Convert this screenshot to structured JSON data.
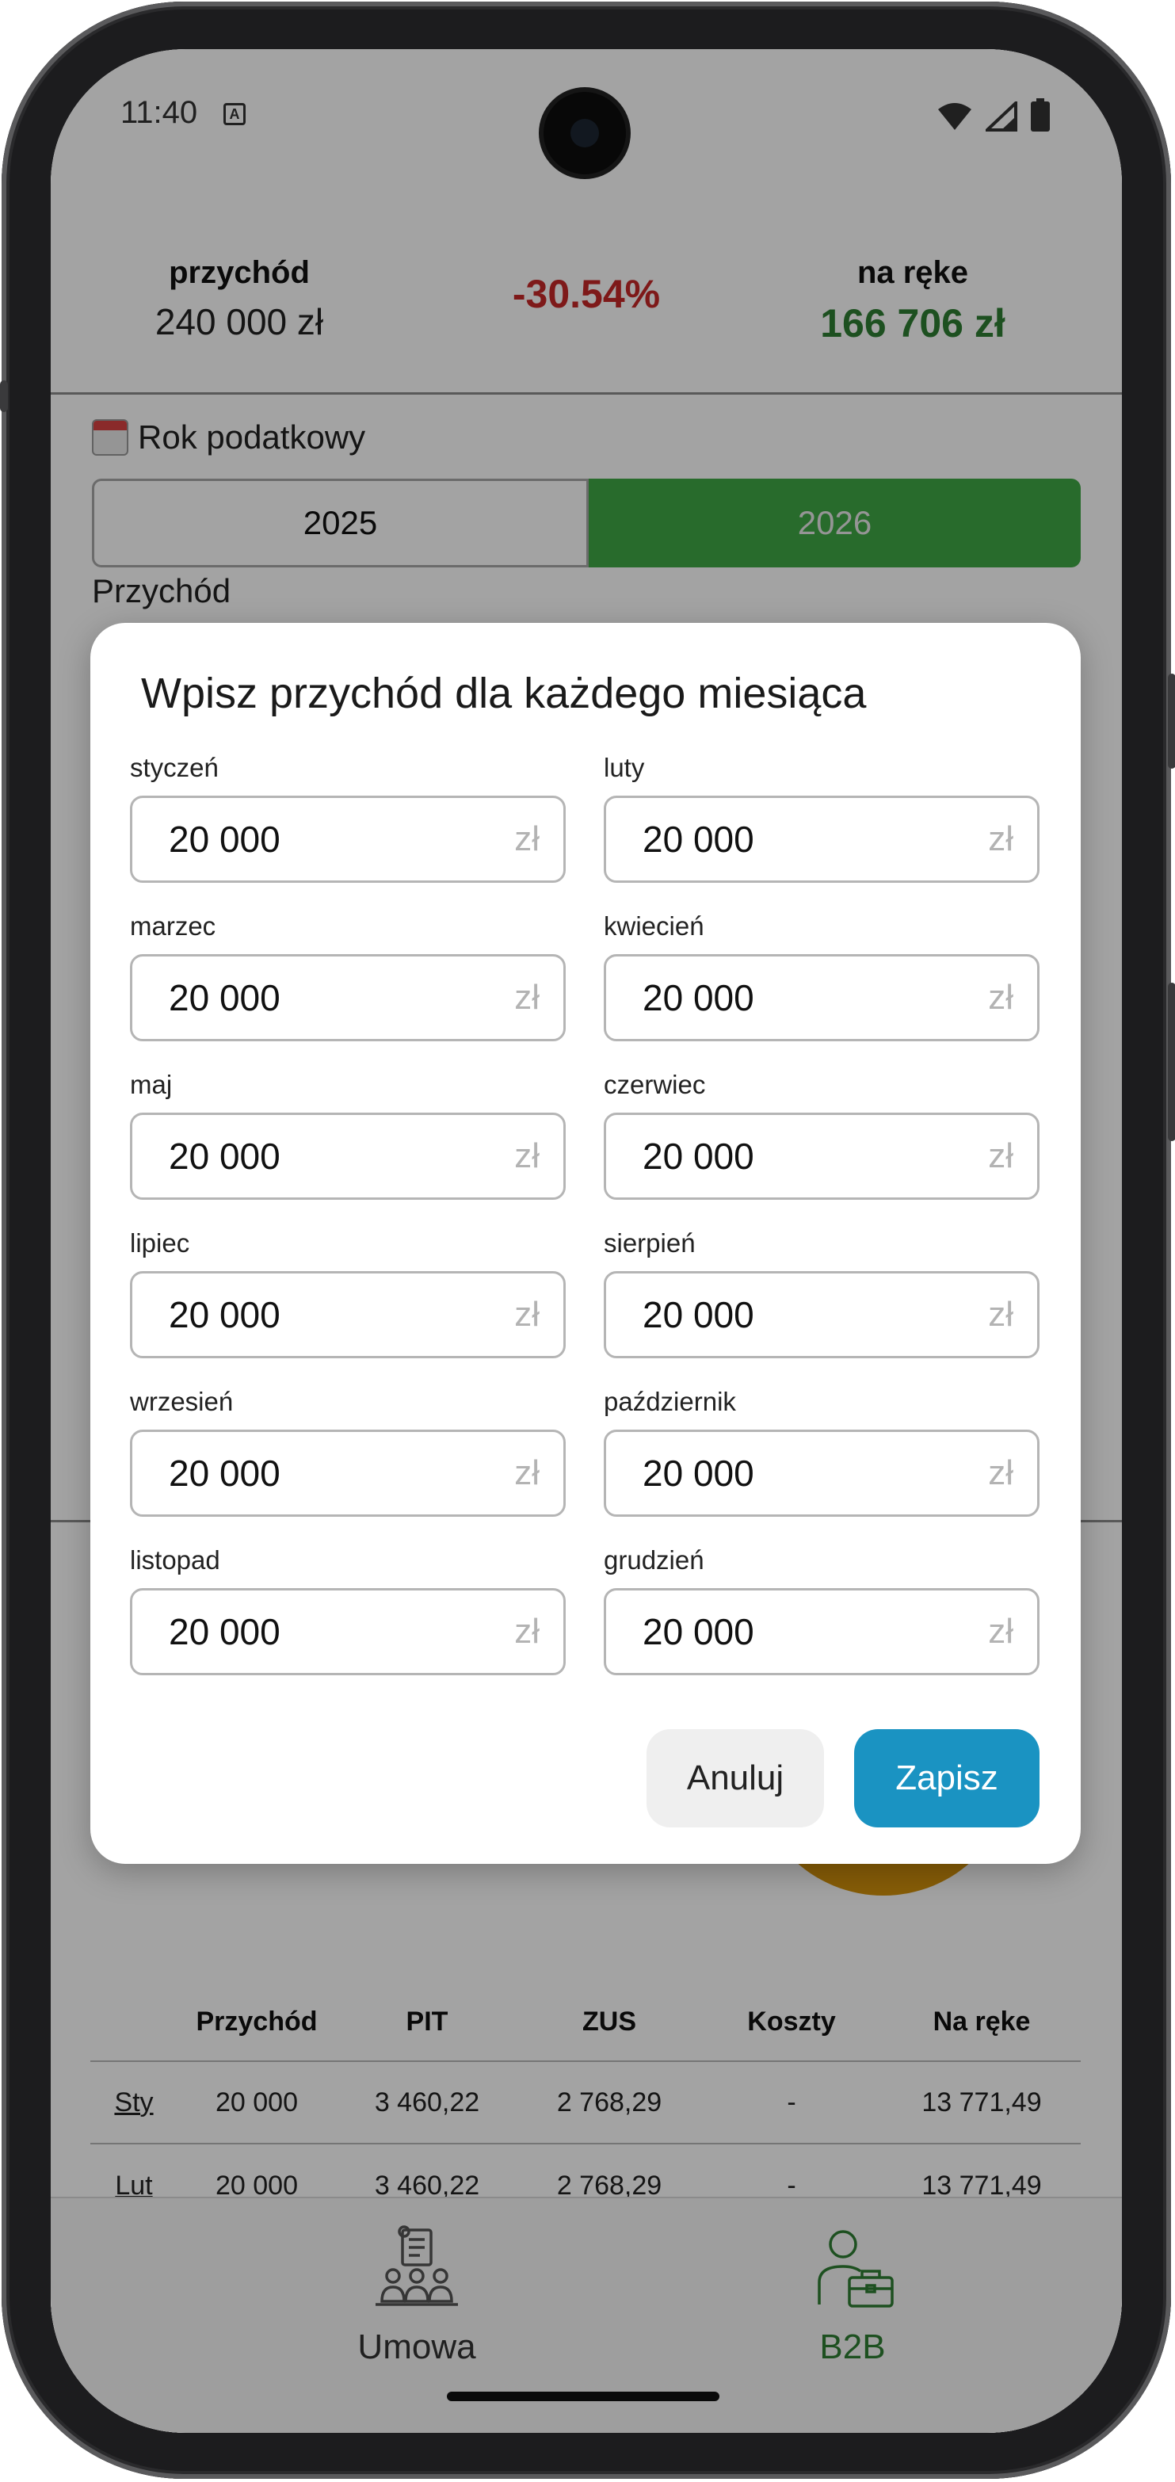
{
  "status_bar": {
    "time": "11:40",
    "badge": "A"
  },
  "summary": {
    "revenue_label": "przychód",
    "revenue_value": "240 000 zł",
    "change_percent": "-30.54%",
    "net_label": "na ręke",
    "net_value": "166 706 zł"
  },
  "tax_year": {
    "label": "Rok podatkowy",
    "options": [
      "2025",
      "2026"
    ],
    "selected": "2026"
  },
  "income_section": {
    "label": "Przychód"
  },
  "modal": {
    "title": "Wpisz przychód dla każdego miesiąca",
    "unit": "zł",
    "months": [
      {
        "label": "styczeń",
        "value": "20 000"
      },
      {
        "label": "luty",
        "value": "20 000"
      },
      {
        "label": "marzec",
        "value": "20 000"
      },
      {
        "label": "kwiecień",
        "value": "20 000"
      },
      {
        "label": "maj",
        "value": "20 000"
      },
      {
        "label": "czerwiec",
        "value": "20 000"
      },
      {
        "label": "lipiec",
        "value": "20 000"
      },
      {
        "label": "sierpień",
        "value": "20 000"
      },
      {
        "label": "wrzesień",
        "value": "20 000"
      },
      {
        "label": "październik",
        "value": "20 000"
      },
      {
        "label": "listopad",
        "value": "20 000"
      },
      {
        "label": "grudzień",
        "value": "20 000"
      }
    ],
    "cancel_label": "Anuluj",
    "save_label": "Zapisz"
  },
  "table": {
    "headers": [
      "",
      "Przychód",
      "PIT",
      "ZUS",
      "Koszty",
      "Na ręke"
    ],
    "rows": [
      [
        "Sty",
        "20 000",
        "3 460,22",
        "2 768,29",
        "-",
        "13 771,49"
      ],
      [
        "Lut",
        "20 000",
        "3 460,22",
        "2 768,29",
        "-",
        "13 771,49"
      ]
    ]
  },
  "bottom_nav": {
    "items": [
      {
        "label": "Umowa",
        "icon": "contract-meeting-icon",
        "active": false
      },
      {
        "label": "B2B",
        "icon": "businessman-briefcase-icon",
        "active": true
      }
    ]
  },
  "colors": {
    "accent_green": "#2e7d32",
    "toggle_green": "#3fa845",
    "negative_red": "#c62828",
    "save_blue": "#1a93c2",
    "chart_orange": "#d4920c"
  }
}
